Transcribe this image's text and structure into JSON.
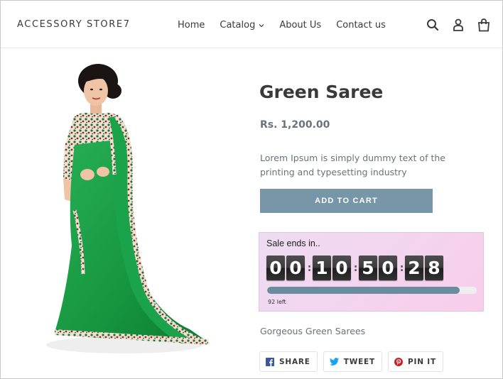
{
  "header": {
    "logo": "ACCESSORY STORE7",
    "nav": [
      {
        "label": "Home"
      },
      {
        "label": "Catalog"
      },
      {
        "label": "About Us"
      },
      {
        "label": "Contact us"
      }
    ],
    "icons": [
      "search-icon",
      "account-icon",
      "cart-icon"
    ]
  },
  "product": {
    "title": "Green Saree",
    "price": "Rs. 1,200.00",
    "description": "Lorem Ipsum is simply dummy text of the printing and typesetting industry",
    "add_to_cart": "ADD TO CART",
    "subtext": "Gorgeous Green Sarees"
  },
  "timer": {
    "label": "Sale ends in..",
    "digits": [
      "0",
      "0",
      "1",
      "0",
      "5",
      "0",
      "2",
      "8"
    ],
    "stock_left": "92 left",
    "stock_fraction": 0.92
  },
  "share": {
    "share": "SHARE",
    "tweet": "TWEET",
    "pin": "PIN IT"
  },
  "colors": {
    "accent": "#7796a8",
    "saree_green": "#1f9a47",
    "facebook": "#3b5998",
    "twitter": "#1da1f2",
    "pinterest": "#cb2027"
  }
}
